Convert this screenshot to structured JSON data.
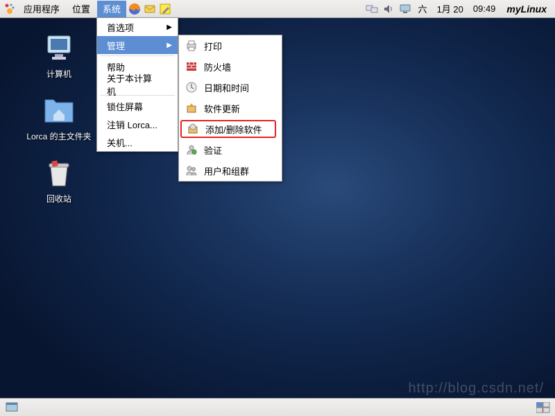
{
  "panel": {
    "applications": "应用程序",
    "places": "位置",
    "system": "系统",
    "clock_day": "六",
    "clock_date": "1月 20",
    "clock_time": "09:49",
    "hostname": "myLinux"
  },
  "desktop_icons": {
    "computer": "计算机",
    "home": "Lorca 的主文件夹",
    "trash": "回收站"
  },
  "system_menu": {
    "preferences": "首选项",
    "administration": "管理",
    "help": "帮助",
    "about": "关于本计算机",
    "lock": "锁住屏幕",
    "logout": "注销 Lorca...",
    "shutdown": "关机..."
  },
  "admin_submenu": {
    "printing": "打印",
    "firewall": "防火墙",
    "datetime": "日期和时间",
    "update": "软件更新",
    "addremove": "添加/删除软件",
    "auth": "验证",
    "users": "用户和组群"
  },
  "watermark": "http://blog.csdn.net/"
}
